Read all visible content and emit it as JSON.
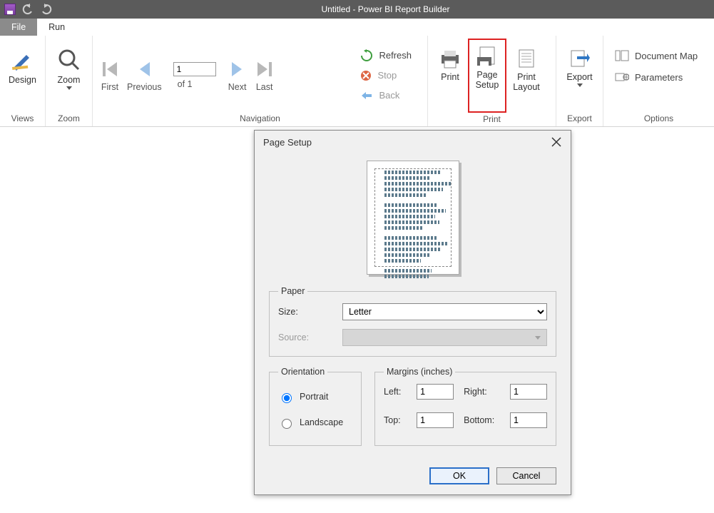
{
  "app": {
    "title": "Untitled - Power BI Report Builder"
  },
  "tabs": {
    "file": "File",
    "run": "Run"
  },
  "ribbon": {
    "views": {
      "design": "Design",
      "label": "Views"
    },
    "zoom": {
      "zoom": "Zoom",
      "label": "Zoom"
    },
    "navigation": {
      "first": "First",
      "previous": "Previous",
      "next": "Next",
      "last": "Last",
      "page_value": "1",
      "of_text": "of  1",
      "refresh": "Refresh",
      "stop": "Stop",
      "back": "Back",
      "label": "Navigation"
    },
    "print": {
      "print": "Print",
      "page_setup": "Page\nSetup",
      "print_layout": "Print\nLayout",
      "label": "Print"
    },
    "export": {
      "export": "Export",
      "label": "Export"
    },
    "options": {
      "doc_map": "Document Map",
      "parameters": "Parameters",
      "label": "Options"
    }
  },
  "dialog": {
    "title": "Page Setup",
    "paper": {
      "legend": "Paper",
      "size_label": "Size:",
      "size_value": "Letter",
      "source_label": "Source:"
    },
    "orientation": {
      "legend": "Orientation",
      "portrait": "Portrait",
      "landscape": "Landscape",
      "selected": "portrait"
    },
    "margins": {
      "legend": "Margins (inches)",
      "left_label": "Left:",
      "left": "1",
      "right_label": "Right:",
      "right": "1",
      "top_label": "Top:",
      "top": "1",
      "bottom_label": "Bottom:",
      "bottom": "1"
    },
    "buttons": {
      "ok": "OK",
      "cancel": "Cancel"
    }
  }
}
